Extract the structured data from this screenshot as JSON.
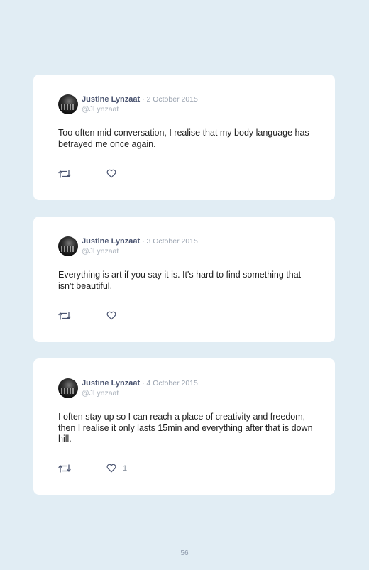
{
  "tweets": [
    {
      "author": "Justine Lynzaat",
      "date": " · 2 October 2015",
      "handle": "@JLynzaat",
      "text": "Too often mid conversation, I realise that my body language has betrayed me once again.",
      "likes": ""
    },
    {
      "author": "Justine Lynzaat",
      "date": " · 3 October 2015",
      "handle": "@JLynzaat",
      "text": "Everything is art if you say it is. It's hard to find something that isn't beautiful.",
      "likes": ""
    },
    {
      "author": "Justine Lynzaat",
      "date": " · 4 October 2015",
      "handle": "@JLynzaat",
      "text": "I often stay up so I can reach a place of creativity and freedom, then I realise it only lasts 15min and everything after that is down hill.",
      "likes": "1"
    }
  ],
  "page_number": "56",
  "colors": {
    "background": "#e1edf4",
    "card": "#ffffff",
    "icon": "#4a5470"
  },
  "icons": {
    "retweet": "retweet-icon",
    "like": "heart-icon"
  }
}
